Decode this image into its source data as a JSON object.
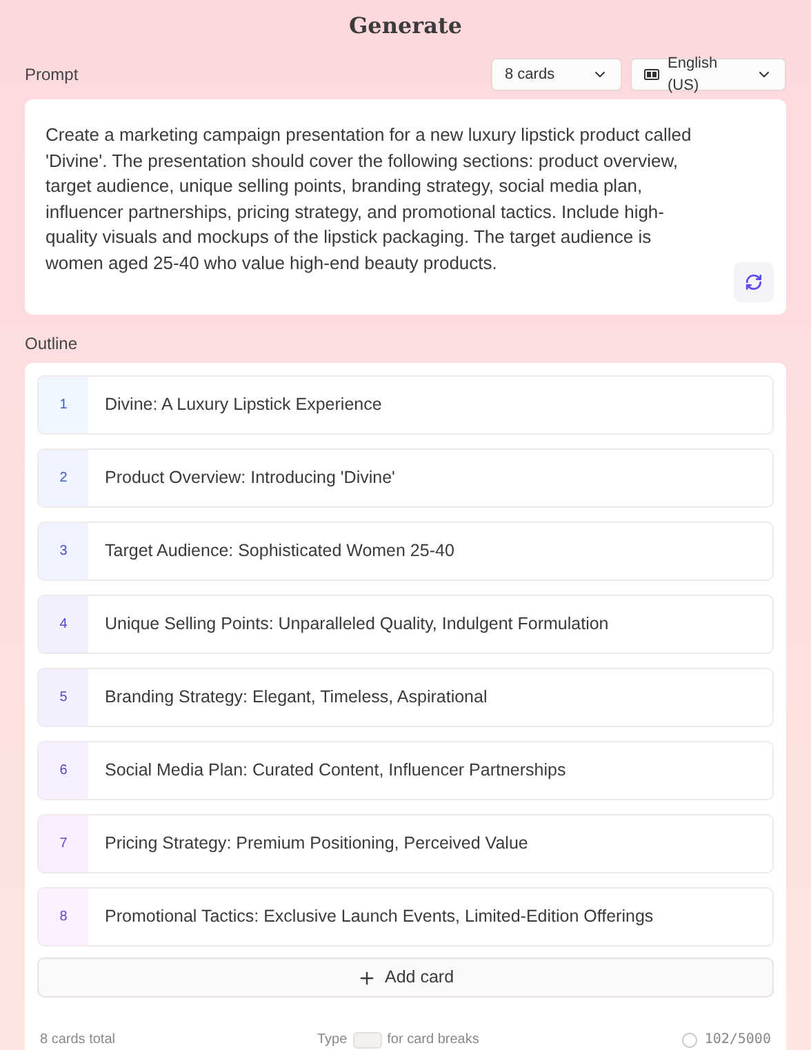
{
  "title": "Generate",
  "prompt": {
    "label": "Prompt",
    "card_count": "8 cards",
    "language": "English (US)",
    "value": "Create a marketing campaign presentation for a new luxury lipstick product called 'Divine'. The presentation should cover the following sections: product overview, target audience, unique selling points, branding strategy, social media plan, influencer partnerships, pricing strategy, and promotional tactics. Include high-quality visuals and mockups of the lipstick packaging. The target audience is women aged 25-40 who value high-end beauty products."
  },
  "outline": {
    "label": "Outline",
    "items": [
      {
        "number": "1",
        "title": "Divine: A Luxury Lipstick Experience"
      },
      {
        "number": "2",
        "title": "Product Overview: Introducing 'Divine'"
      },
      {
        "number": "3",
        "title": "Target Audience: Sophisticated Women 25-40"
      },
      {
        "number": "4",
        "title": "Unique Selling Points: Unparalleled Quality, Indulgent Formulation"
      },
      {
        "number": "5",
        "title": "Branding Strategy: Elegant, Timeless, Aspirational"
      },
      {
        "number": "6",
        "title": "Social Media Plan: Curated Content, Influencer Partnerships"
      },
      {
        "number": "7",
        "title": "Pricing Strategy: Premium Positioning, Perceived Value"
      },
      {
        "number": "8",
        "title": "Promotional Tactics: Exclusive Launch Events, Limited-Edition Offerings"
      }
    ],
    "add_button": "Add card"
  },
  "footer": {
    "total": "8 cards total",
    "hint_before": "Type",
    "hint_after": "for card breaks",
    "count": "102/5000"
  }
}
